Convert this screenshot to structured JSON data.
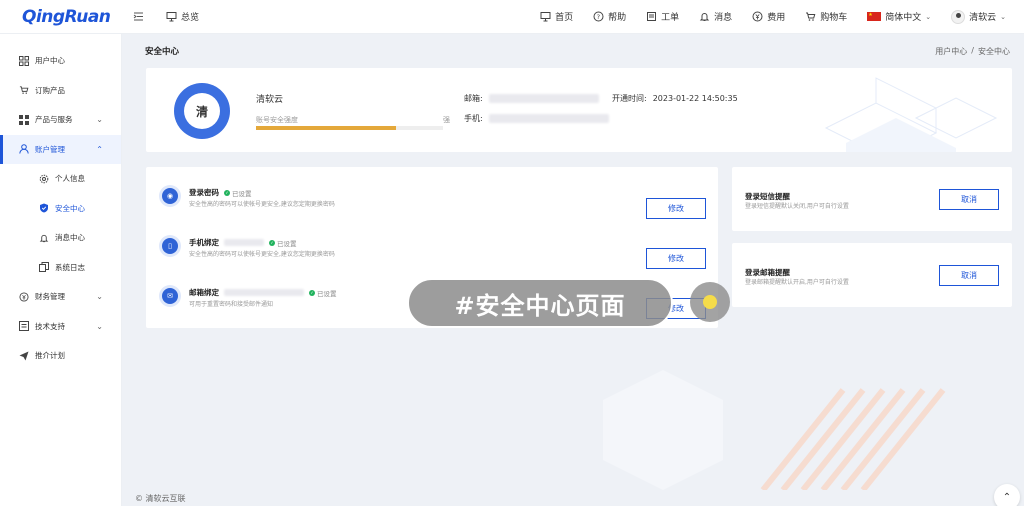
{
  "brand": {
    "logo": "QingRuan"
  },
  "header": {
    "overview": "总览",
    "nav": [
      {
        "label": "首页",
        "icon": "monitor-icon"
      },
      {
        "label": "帮助",
        "icon": "help-icon"
      },
      {
        "label": "工单",
        "icon": "ticket-icon"
      },
      {
        "label": "消息",
        "icon": "bell-icon"
      },
      {
        "label": "费用",
        "icon": "currency-icon"
      },
      {
        "label": "购物车",
        "icon": "cart-icon"
      }
    ],
    "language": "简体中文",
    "username": "清软云"
  },
  "sidebar": {
    "items": [
      {
        "label": "用户中心",
        "icon": "grid-icon"
      },
      {
        "label": "订购产品",
        "icon": "cart-icon"
      },
      {
        "label": "产品与服务",
        "icon": "apps-icon"
      },
      {
        "label": "账户管理",
        "icon": "user-icon"
      },
      {
        "label": "个人信息",
        "icon": "gear-icon"
      },
      {
        "label": "安全中心",
        "icon": "shield-icon"
      },
      {
        "label": "消息中心",
        "icon": "bell-icon"
      },
      {
        "label": "系统日志",
        "icon": "log-icon"
      },
      {
        "label": "财务管理",
        "icon": "currency-icon"
      },
      {
        "label": "技术支持",
        "icon": "support-icon"
      },
      {
        "label": "推介计划",
        "icon": "send-icon"
      }
    ]
  },
  "page": {
    "title": "安全中心",
    "breadcrumb": [
      "用户中心",
      "/",
      "安全中心"
    ]
  },
  "profile": {
    "avatar_char": "清",
    "name": "清软云",
    "strength_label": "账号安全强度",
    "strength_end": "强",
    "strength_fraction": 0.75,
    "email_label": "邮箱:",
    "phone_label": "手机:",
    "opened_label": "开通时间:",
    "opened_time": "2023-01-22 14:50:35"
  },
  "security": {
    "status_set": "已设置",
    "modify_label": "修改",
    "rows": [
      {
        "title": "登录密码",
        "desc": "安全性高的密码可以使帐号更安全,建议您定期更换密码"
      },
      {
        "title": "手机绑定",
        "desc": "安全性高的密码可以使帐号更安全,建议您定期更换密码"
      },
      {
        "title": "邮箱绑定",
        "desc": "可用于重置密码和接受邮件通知"
      }
    ]
  },
  "notices": {
    "cancel_label": "取消",
    "items": [
      {
        "title": "登录短信提醒",
        "desc": "登录短信提醒默认关闭,用户可自行设置"
      },
      {
        "title": "登录邮箱提醒",
        "desc": "登录邮箱提醒默认开启,用户可自行设置"
      }
    ]
  },
  "overlay": {
    "caption": "#安全中心页面"
  },
  "footer": {
    "copyright": "© 清软云互联"
  },
  "colors": {
    "accent": "#1e55d8",
    "strength": "#e4a83a",
    "success": "#22b35e"
  }
}
